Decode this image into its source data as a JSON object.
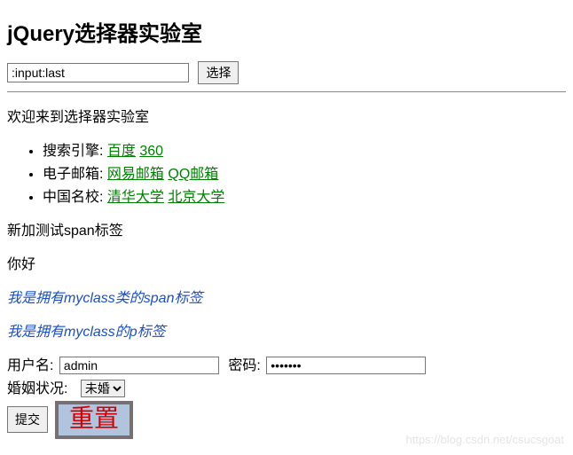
{
  "title": "jQuery选择器实验室",
  "selector_input_value": ":input:last",
  "select_button": "选择",
  "welcome": "欢迎来到选择器实验室",
  "list": [
    {
      "label": "搜索引擎: ",
      "links": [
        {
          "text": "百度"
        },
        {
          "text": "360"
        }
      ]
    },
    {
      "label": "电子邮箱: ",
      "links": [
        {
          "text": "网易邮箱"
        },
        {
          "text": "QQ邮箱"
        }
      ]
    },
    {
      "label": "中国名校: ",
      "links": [
        {
          "text": "清华大学"
        },
        {
          "text": "北京大学"
        }
      ]
    }
  ],
  "span_test": "新加测试span标签",
  "hello": "你好",
  "myclass_span": "我是拥有myclass类的span标签",
  "myclass_p": "我是拥有myclass的p标签",
  "form": {
    "user_label": "用户名: ",
    "user_value": "admin",
    "pwd_label": "密码: ",
    "pwd_value": "•••••••",
    "marital_label": "婚姻状况: ",
    "marital_selected": "未婚",
    "submit": "提交",
    "reset": "重置"
  },
  "watermark": "https://blog.csdn.net/csucsgoat"
}
